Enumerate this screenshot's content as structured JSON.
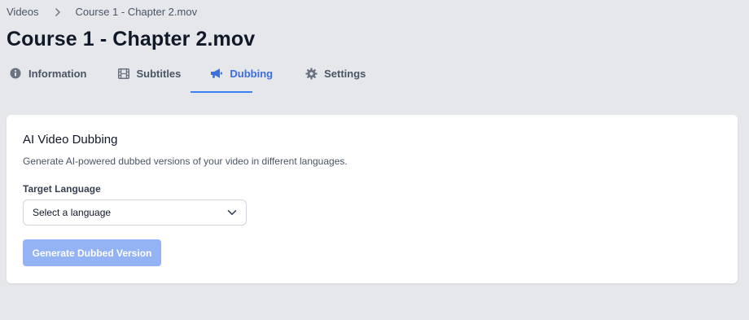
{
  "breadcrumb": {
    "root": "Videos",
    "current": "Course 1 - Chapter 2.mov"
  },
  "page": {
    "title": "Course 1 - Chapter 2.mov"
  },
  "tabs": [
    {
      "label": "Information",
      "icon": "info-circle-icon",
      "active": false
    },
    {
      "label": "Subtitles",
      "icon": "film-icon",
      "active": false
    },
    {
      "label": "Dubbing",
      "icon": "megaphone-icon",
      "active": true
    },
    {
      "label": "Settings",
      "icon": "gear-icon",
      "active": false
    }
  ],
  "dubbing_card": {
    "title": "AI Video Dubbing",
    "description": "Generate AI-powered dubbed versions of your video in different languages.",
    "target_language_label": "Target Language",
    "target_language_value": "Select a language",
    "generate_button_label": "Generate Dubbed Version",
    "generate_button_disabled": true
  },
  "colors": {
    "background": "#e5e7eb",
    "accent": "#3b82f6",
    "active_tab_text": "#3b6fdf",
    "disabled_button": "#93b3f5",
    "muted_text": "#4b5563"
  }
}
